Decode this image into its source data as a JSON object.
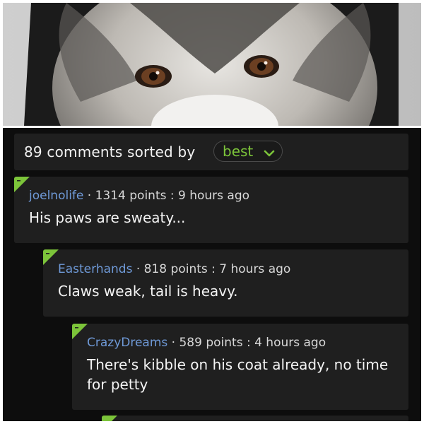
{
  "sort_bar": {
    "count_text": "89 comments sorted by",
    "sort_value": "best",
    "accent_color": "#7cc43a"
  },
  "comments": [
    {
      "author": "joelnolife",
      "separator": " · ",
      "score_text": "1314 points : 9 hours ago",
      "body": "His paws are sweaty..."
    },
    {
      "author": "Easterhands",
      "separator": " · ",
      "score_text": "818 points : 7 hours ago",
      "body": "Claws weak, tail is heavy."
    },
    {
      "author": "CrazyDreams",
      "separator": " · ",
      "score_text": "589 points : 4 hours ago",
      "body": "There's kibble on his coat already, no time for petty"
    }
  ],
  "colors": {
    "author_link": "#6f9ad8",
    "card_background": "#1f1f1f",
    "flag_green": "#7cc43a"
  },
  "icons": {
    "sort_dropdown": "chevron-down-icon",
    "comment_marker": "green-corner-flag-icon"
  }
}
